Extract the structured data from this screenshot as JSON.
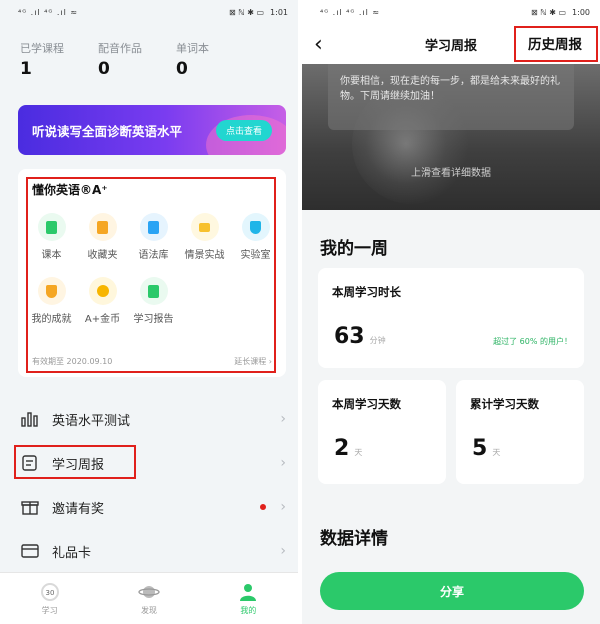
{
  "left": {
    "status": {
      "signal": "⁴ᴳ .ıl ⁴ᴳ .ıl ≈",
      "icons": "⊠ ℕ ✱ ▭",
      "time": "1:01"
    },
    "stats": [
      {
        "label": "已学课程",
        "value": "1"
      },
      {
        "label": "配音作品",
        "value": "0"
      },
      {
        "label": "单词本",
        "value": "0"
      }
    ],
    "banner": {
      "text": "听说读写全面诊断英语水平",
      "button": "点击查看"
    },
    "card": {
      "title": "懂你英语®A⁺",
      "items": [
        {
          "label": "课本",
          "color": "#2bc96a",
          "bg": "#eafaf0"
        },
        {
          "label": "收藏夹",
          "color": "#f5a623",
          "bg": "#fff5e2"
        },
        {
          "label": "语法库",
          "color": "#2aa4f4",
          "bg": "#e6f4fe"
        },
        {
          "label": "情景实战",
          "color": "#f7c12e",
          "bg": "#fff8e0"
        },
        {
          "label": "实验室",
          "color": "#1fb5e8",
          "bg": "#e3f6fd"
        },
        {
          "label": "我的成就",
          "color": "#f5a623",
          "bg": "#fff5e2"
        },
        {
          "label": "A+金币",
          "color": "#f7b500",
          "bg": "#fff7dc"
        },
        {
          "label": "学习报告",
          "color": "#2bc96a",
          "bg": "#eafaf0"
        }
      ],
      "valid_until": "有效期至 2020.09.10",
      "renew": "延长课程 ›"
    },
    "menu": [
      {
        "label": "英语水平测试",
        "icon": "bar-chart-icon"
      },
      {
        "label": "学习周报",
        "icon": "report-icon"
      },
      {
        "label": "邀请有奖",
        "icon": "gift-icon"
      },
      {
        "label": "礼品卡",
        "icon": "card-icon"
      }
    ],
    "tabs": [
      {
        "label": "学习",
        "badge": "30"
      },
      {
        "label": "发现",
        "badge": ""
      },
      {
        "label": "我的",
        "badge": ""
      }
    ]
  },
  "right": {
    "status": {
      "signal": "⁴ᴳ .ıl ⁴ᴳ .ıl ≈",
      "icons": "⊠ ℕ ✱ ▭",
      "time": "1:00"
    },
    "nav": {
      "back": "‹",
      "title": "学习周报",
      "history": "历史周报"
    },
    "quote": "你要相信，现在走的每一步，都是给未来最好的礼物。下周请继续加油！",
    "scroll_hint": "上滑查看详细数据",
    "section_week": "我的一周",
    "study_time": {
      "title": "本周学习时长",
      "value": "63",
      "unit": "分钟",
      "beat": "超过了 60% 的用户！"
    },
    "study_days": {
      "title": "本周学习天数",
      "value": "2",
      "unit": "天"
    },
    "total_days": {
      "title": "累计学习天数",
      "value": "5",
      "unit": "天"
    },
    "section_detail": "数据详情",
    "share": "分享",
    "colors": {
      "accent": "#2bc96a",
      "highlight": "#e0201b"
    }
  }
}
